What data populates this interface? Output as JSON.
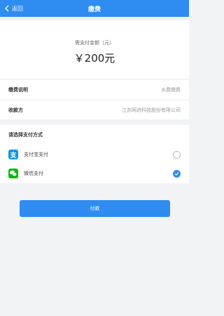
{
  "colors": {
    "primary": "#2f8cf0",
    "alipay": "#1296db",
    "wechat": "#09bb07",
    "background": "#f2f3f5"
  },
  "header": {
    "back_label": "返回",
    "title": "缴费"
  },
  "amount": {
    "label": "需支付金额（元）",
    "value": "￥200元"
  },
  "info": {
    "rows": [
      {
        "key": "缴费说明",
        "value": "水费缴费"
      },
      {
        "key": "收款方",
        "value": "江苏网进科技股份有限公司"
      }
    ]
  },
  "payment": {
    "title": "请选择支付方式",
    "options": [
      {
        "label": "支付宝支付",
        "icon": "alipay-icon",
        "icon_glyph": "支",
        "selected": false
      },
      {
        "label": "微信支付",
        "icon": "wechat-icon",
        "icon_glyph": "",
        "selected": true
      }
    ]
  },
  "submit_label": "付款"
}
